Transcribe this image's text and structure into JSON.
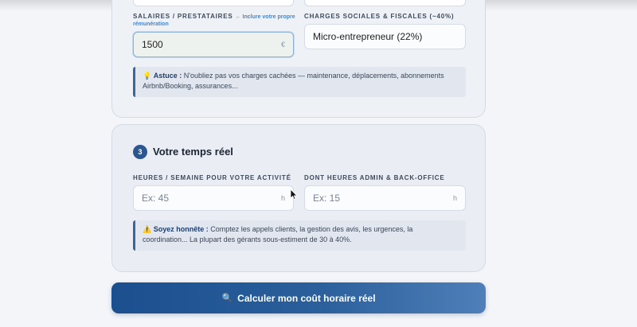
{
  "section2": {
    "salaries_label": "SALAIRES / PRESTATAIRES",
    "salaries_hint_a": "← Inclure votre propre",
    "salaries_hint_b": "rémunération",
    "salaries_value": "1500",
    "salaries_unit": "€",
    "charges_label": "CHARGES SOCIALES & FISCALES (~40%)",
    "charges_value": "Micro-entrepreneur (22%)",
    "tip_icon": "💡",
    "tip_bold": "Astuce :",
    "tip_text_a": " N'oubliez pas vos charges cachées — maintenance, déplacements, abonnements",
    "tip_text_b": "Airbnb/Booking, assurances..."
  },
  "section3": {
    "step_number": "3",
    "title": "Votre temps réel",
    "hours_label": "HEURES / SEMAINE POUR VOTRE ACTIVITÉ",
    "hours_placeholder": "Ex: 45",
    "hours_unit": "h",
    "admin_label": "DONT HEURES ADMIN & BACK-OFFICE",
    "admin_placeholder": "Ex: 15",
    "admin_unit": "h",
    "warn_icon": "⚠️",
    "warn_bold": "Soyez honnête :",
    "warn_text_a": " Comptez les appels clients, la gestion des avis, les urgences, la",
    "warn_text_b": "coordination... La plupart des gérants sous-estiment de 30 à 40%."
  },
  "cta": {
    "icon": "🔍",
    "label": "Calculer mon coût horaire réel"
  },
  "colors": {
    "accent": "#2c568f",
    "cta_start": "#1b4f8e",
    "cta_end": "#4f7fb8",
    "hint": "#4a86c8"
  }
}
